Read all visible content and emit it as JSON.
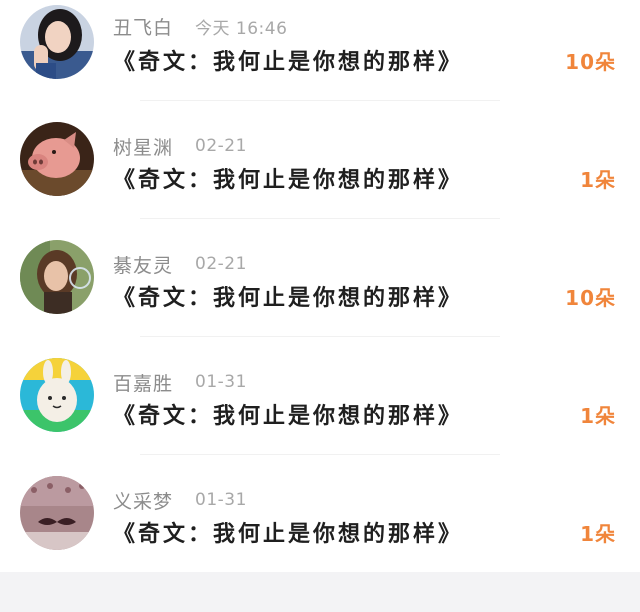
{
  "list": {
    "items": [
      {
        "name": "丑飞白",
        "time": "今天 16:46",
        "title": "《奇文：我何止是你想的那样》",
        "count": "10朵",
        "avatar": "portrait-woman-dark-hair-icon"
      },
      {
        "name": "树星渊",
        "time": "02-21",
        "title": "《奇文：我何止是你想的那样》",
        "count": "1朵",
        "avatar": "pig-photo-icon"
      },
      {
        "name": "綦友灵",
        "time": "02-21",
        "title": "《奇文：我何止是你想的那样》",
        "count": "10朵",
        "avatar": "portrait-woman-bubble-icon"
      },
      {
        "name": "百嘉胜",
        "time": "01-31",
        "title": "《奇文：我何止是你想的那样》",
        "count": "1朵",
        "avatar": "cartoon-bunny-icon"
      },
      {
        "name": "义采梦",
        "time": "01-31",
        "title": "《奇文：我何止是你想的那样》",
        "count": "1朵",
        "avatar": "mustache-pattern-icon"
      }
    ]
  },
  "colors": {
    "count": "#f0853b",
    "name": "#8c8c8c",
    "title": "#1f1f1f",
    "footer": "#f3f3f5"
  }
}
